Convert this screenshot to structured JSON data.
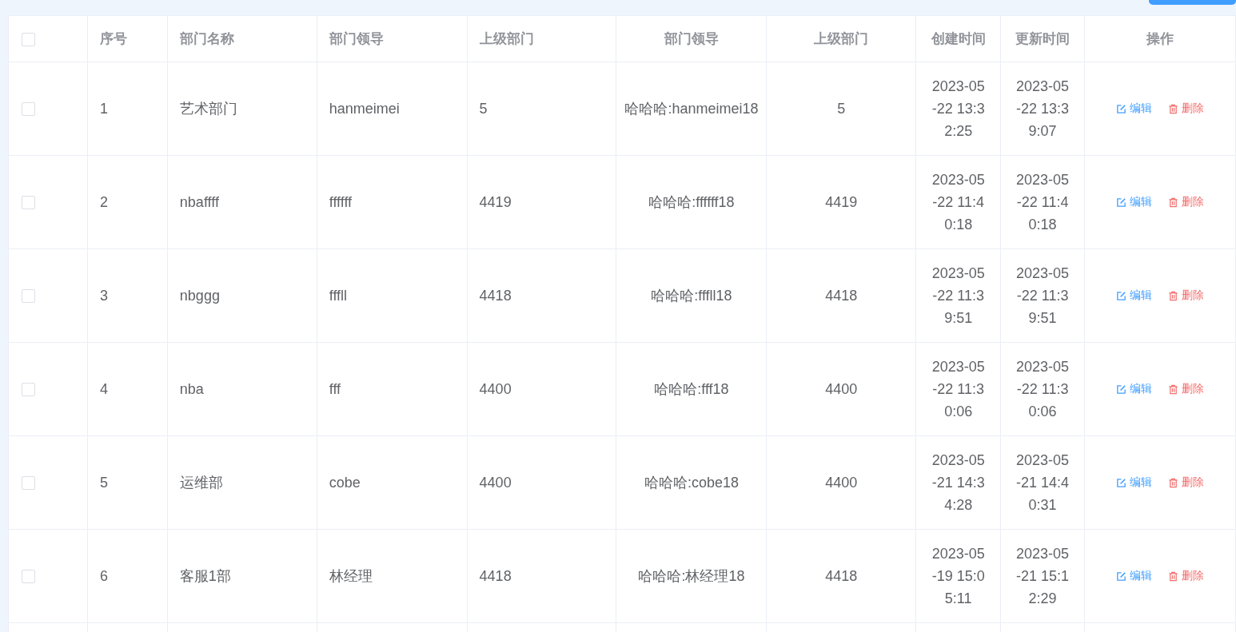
{
  "header_checkbox": {
    "checked": false
  },
  "columns": [
    "序号",
    "部门名称",
    "部门领导",
    "上级部门",
    "部门领导",
    "上级部门",
    "创建时间",
    "更新时间",
    "操作"
  ],
  "rows": [
    {
      "checked": false,
      "cells": [
        "1",
        "艺术部门",
        "hanmeimei",
        "5",
        "哈哈哈:hanmeimei18",
        "5",
        "2023-05-22 13:32:25",
        "2023-05-22 13:39:07"
      ],
      "actions": [
        {
          "kind": "edit",
          "label": "编辑"
        },
        {
          "kind": "delete",
          "label": "删除"
        }
      ]
    },
    {
      "checked": false,
      "cells": [
        "2",
        "nbaffff",
        "ffffff",
        "4419",
        "哈哈哈:ffffff18",
        "4419",
        "2023-05-22 11:40:18",
        "2023-05-22 11:40:18"
      ],
      "actions": [
        {
          "kind": "edit",
          "label": "编辑"
        },
        {
          "kind": "delete",
          "label": "删除"
        }
      ]
    },
    {
      "checked": false,
      "cells": [
        "3",
        "nbggg",
        "fffll",
        "4418",
        "哈哈哈:fffll18",
        "4418",
        "2023-05-22 11:39:51",
        "2023-05-22 11:39:51"
      ],
      "actions": [
        {
          "kind": "edit",
          "label": "编辑"
        },
        {
          "kind": "delete",
          "label": "删除"
        }
      ]
    },
    {
      "checked": false,
      "cells": [
        "4",
        "nba",
        "fff",
        "4400",
        "哈哈哈:fff18",
        "4400",
        "2023-05-22 11:30:06",
        "2023-05-22 11:30:06"
      ],
      "actions": [
        {
          "kind": "edit",
          "label": "编辑"
        },
        {
          "kind": "delete",
          "label": "删除"
        }
      ]
    },
    {
      "checked": false,
      "cells": [
        "5",
        "运维部",
        "cobe",
        "4400",
        "哈哈哈:cobe18",
        "4400",
        "2023-05-21 14:34:28",
        "2023-05-21 14:40:31"
      ],
      "actions": [
        {
          "kind": "edit",
          "label": "编辑"
        },
        {
          "kind": "delete",
          "label": "删除"
        }
      ]
    },
    {
      "checked": false,
      "cells": [
        "6",
        "客服1部",
        "林经理",
        "4418",
        "哈哈哈:林经理18",
        "4418",
        "2023-05-19 15:05:11",
        "2023-05-21 15:12:29"
      ],
      "actions": [
        {
          "kind": "edit",
          "label": "编辑"
        },
        {
          "kind": "delete",
          "label": "删除"
        }
      ]
    }
  ]
}
